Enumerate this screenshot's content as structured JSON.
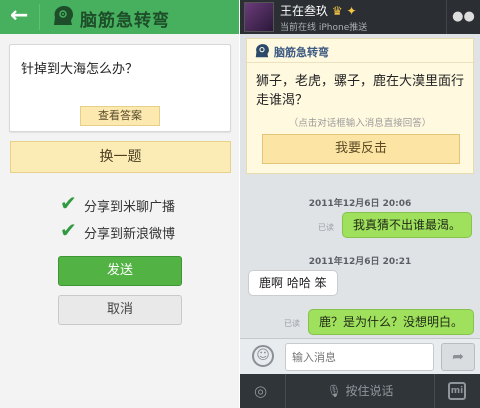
{
  "left": {
    "header": {
      "title": "脑筋急转弯"
    },
    "question": "针掉到大海怎么办？",
    "answer_button": "查看答案",
    "change_button": "换一题",
    "shares": [
      {
        "label": "分享到米聊广播",
        "checked": true
      },
      {
        "label": "分享到新浪微博",
        "checked": true
      }
    ],
    "send_button": "发送",
    "cancel_button": "取消"
  },
  "right": {
    "header": {
      "name": "王在叁玖",
      "status": "当前在线 iPhone推送"
    },
    "card": {
      "brand": "脑筋急转弯",
      "question": "狮子，老虎，骡子，鹿在大漠里面行走谁渴？",
      "hint": "（点击对话框输入消息直接回答）",
      "button": "我要反击"
    },
    "messages": [
      {
        "timestamp": "2011年12月6日 20:06",
        "read": "已读",
        "text": "我真猜不出谁最渴。",
        "dir": "out"
      },
      {
        "timestamp": "2011年12月6日 20:21",
        "text": "鹿啊 哈哈 笨",
        "dir": "in"
      },
      {
        "read": "已读",
        "text": "鹿？是为什么？没想明白。",
        "dir": "out"
      }
    ],
    "input_placeholder": "输入消息",
    "voice_label": "按住说话",
    "mi_label": "mi"
  },
  "colors": {
    "accent_green": "#47b05e",
    "send_green": "#52b344",
    "bubble_green": "#9fe05d",
    "dark_bar": "#2b2f33"
  }
}
